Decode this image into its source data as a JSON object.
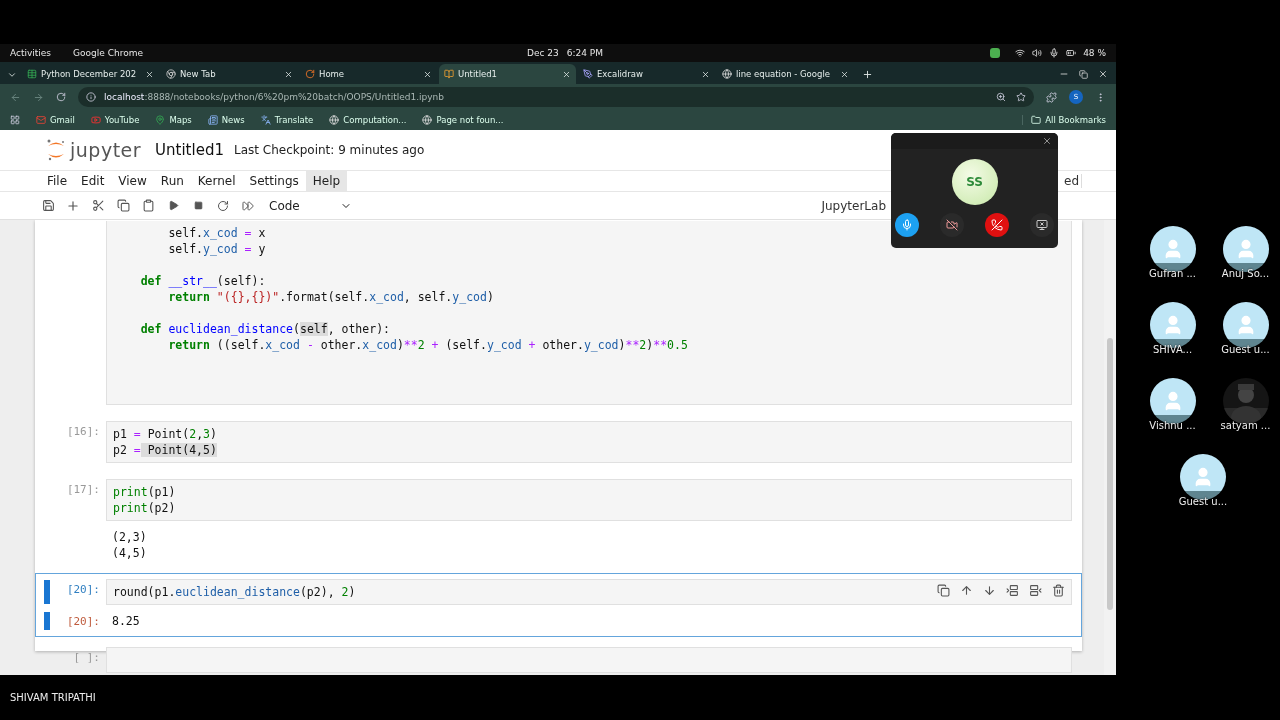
{
  "system_bar": {
    "activities": "Activities",
    "app": "Google Chrome",
    "date": "Dec 23",
    "time": "6:24 PM",
    "battery": "48 %"
  },
  "browser": {
    "tabs": [
      {
        "title": "Python December 202",
        "selected": false
      },
      {
        "title": "New Tab",
        "selected": false
      },
      {
        "title": "Home",
        "selected": false
      },
      {
        "title": "Untitled1",
        "selected": true
      },
      {
        "title": "Excalidraw",
        "selected": false
      },
      {
        "title": "line equation - Google",
        "selected": false
      }
    ],
    "url_host": "localhost",
    "url_path": ":8888/notebooks/python/6%20pm%20batch/OOPS/Untitled1.ipynb",
    "profile": "S",
    "bookmarks": [
      "Gmail",
      "YouTube",
      "Maps",
      "News",
      "Translate",
      "Computation...",
      "Page not foun..."
    ],
    "all_bookmarks": "All Bookmarks"
  },
  "jupyter": {
    "logo_text": "jupyter",
    "title": "Untitled1",
    "checkpoint": "Last Checkpoint: 9 minutes ago",
    "menu": [
      {
        "label": "File",
        "selected": false
      },
      {
        "label": "Edit",
        "selected": false
      },
      {
        "label": "View",
        "selected": false
      },
      {
        "label": "Run",
        "selected": false
      },
      {
        "label": "Kernel",
        "selected": false
      },
      {
        "label": "Settings",
        "selected": false
      },
      {
        "label": "Help",
        "selected": true
      }
    ],
    "trust_fragment": "ed",
    "cell_type": "Code",
    "kernel_label": "JupyterLab",
    "cells": [
      {
        "active": false,
        "blocks": [
          [
            [
              {
                "kind": "p",
                "text": "        self."
              },
              {
                "kind": "attr",
                "text": "x_cod"
              },
              {
                "kind": "op",
                "text": " ="
              },
              {
                "kind": "p",
                "text": " x"
              }
            ],
            [
              {
                "kind": "p",
                "text": "        self."
              },
              {
                "kind": "attr",
                "text": "y_cod"
              },
              {
                "kind": "op",
                "text": " ="
              },
              {
                "kind": "p",
                "text": " y"
              }
            ]
          ],
          [
            [
              {
                "kind": "kw",
                "text": "    def"
              },
              {
                "kind": "fn",
                "text": " __str__"
              },
              {
                "kind": "p",
                "text": "(self):"
              }
            ],
            [
              {
                "kind": "kw",
                "text": "        return"
              },
              {
                "kind": "str",
                "text": " \"({},{})\""
              },
              {
                "kind": "p",
                "text": ".format(self."
              },
              {
                "kind": "attr",
                "text": "x_cod"
              },
              {
                "kind": "p",
                "text": ", self."
              },
              {
                "kind": "attr",
                "text": "y_cod"
              },
              {
                "kind": "p",
                "text": ")"
              }
            ]
          ],
          [
            [
              {
                "kind": "kw",
                "text": "    def"
              },
              {
                "kind": "fn",
                "text": " euclidean_distance"
              },
              {
                "kind": "p",
                "text": "("
              },
              {
                "kind": "match",
                "text": "self"
              },
              {
                "kind": "p",
                "text": ", other):"
              }
            ],
            [
              {
                "kind": "kw",
                "text": "        return"
              },
              {
                "kind": "p",
                "text": " ((self."
              },
              {
                "kind": "attr",
                "text": "x_cod"
              },
              {
                "kind": "op",
                "text": " -"
              },
              {
                "kind": "p",
                "text": " other."
              },
              {
                "kind": "attr",
                "text": "x_cod"
              },
              {
                "kind": "p",
                "text": ")"
              },
              {
                "kind": "op",
                "text": "**"
              },
              {
                "kind": "num",
                "text": "2"
              },
              {
                "kind": "op",
                "text": " +"
              },
              {
                "kind": "p",
                "text": " (self."
              },
              {
                "kind": "attr",
                "text": "y_cod"
              },
              {
                "kind": "op",
                "text": " +"
              },
              {
                "kind": "p",
                "text": " other."
              },
              {
                "kind": "attr",
                "text": "y_cod"
              },
              {
                "kind": "p",
                "text": ")"
              },
              {
                "kind": "op",
                "text": "**"
              },
              {
                "kind": "num",
                "text": "2"
              },
              {
                "kind": "p",
                "text": ")"
              },
              {
                "kind": "op",
                "text": "**"
              },
              {
                "kind": "num",
                "text": "0.5"
              }
            ]
          ]
        ]
      },
      {
        "prompt": "[16]:",
        "active": false,
        "blocks": [
          [
            [
              {
                "kind": "p",
                "text": "p1"
              },
              {
                "kind": "op",
                "text": " ="
              },
              {
                "kind": "p",
                "text": " Point("
              },
              {
                "kind": "num",
                "text": "2"
              },
              {
                "kind": "p",
                "text": ","
              },
              {
                "kind": "num",
                "text": "3"
              },
              {
                "kind": "p",
                "text": ")"
              }
            ],
            [
              {
                "kind": "p",
                "text": "p2"
              },
              {
                "kind": "op",
                "text": " ="
              },
              {
                "kind": "match",
                "text": " Point(4,5)"
              }
            ]
          ]
        ]
      },
      {
        "prompt": "[17]:",
        "active": false,
        "blocks": [
          [
            [
              {
                "kind": "bi",
                "text": "print"
              },
              {
                "kind": "p",
                "text": "(p1)"
              }
            ],
            [
              {
                "kind": "bi",
                "text": "print"
              },
              {
                "kind": "p",
                "text": "(p2)"
              }
            ]
          ]
        ],
        "output": {
          "lines": [
            "(2,3)",
            "(4,5)"
          ]
        }
      },
      {
        "prompt": "[20]:",
        "active": true,
        "blocks": [
          [
            [
              {
                "kind": "p",
                "text": "round(p1."
              },
              {
                "kind": "attr",
                "text": "euclidean_distance"
              },
              {
                "kind": "p",
                "text": "(p2), "
              },
              {
                "kind": "num",
                "text": "2"
              },
              {
                "kind": "p",
                "text": ")"
              }
            ]
          ]
        ],
        "output": {
          "prompt": "[20]:",
          "lines": [
            "8.25"
          ]
        }
      },
      {
        "prompt": "[ ]:",
        "active": false
      }
    ]
  },
  "call": {
    "avatar": "SS"
  },
  "participants": [
    {
      "name": "Gufran ...",
      "kind": "avatar"
    },
    {
      "name": "Anuj So...",
      "kind": "avatar"
    },
    {
      "name": "SHIVA...",
      "kind": "avatar"
    },
    {
      "name": "Guest u...",
      "kind": "avatar"
    },
    {
      "name": "Vishnu ...",
      "kind": "avatar"
    },
    {
      "name": "satyam ...",
      "kind": "picture"
    },
    {
      "name": "Guest u...",
      "kind": "avatar"
    }
  ],
  "presenter": "SHIVAM TRIPATHI"
}
